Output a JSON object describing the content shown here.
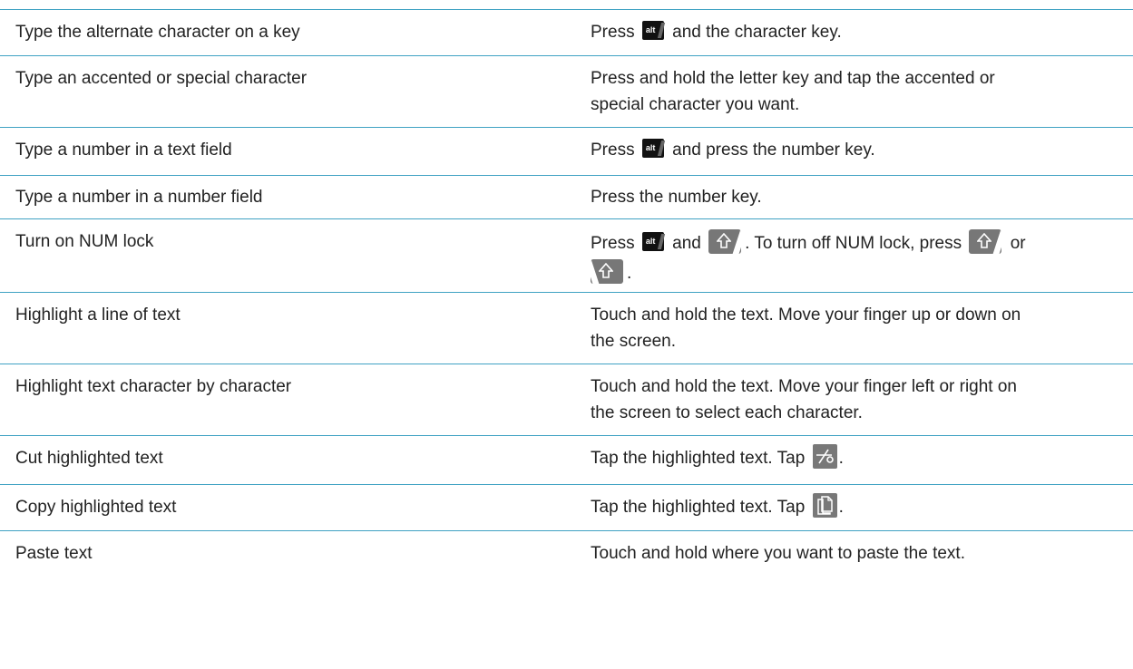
{
  "rows": [
    {
      "action": "Type the alternate character on a key",
      "result": [
        "Press",
        "alt",
        "and the character key."
      ]
    },
    {
      "action": "Type an accented or special character",
      "result": [
        "Press and hold the letter key and tap the accented or",
        "special character you want."
      ]
    },
    {
      "action": "Type a number in a text field",
      "result": [
        "Press",
        "alt",
        "and press the number key."
      ]
    },
    {
      "action": "Type a number in a number field",
      "result": [
        "Press the number key."
      ]
    },
    {
      "action": "Turn on NUM lock",
      "result": [
        "Press",
        "alt",
        "and",
        ". To turn off NUM lock, press",
        "or",
        "."
      ]
    },
    {
      "action": "Highlight a line of text",
      "result": [
        "Touch and hold the text. Move your finger up or down on",
        "the screen."
      ]
    },
    {
      "action": "Highlight text character by character",
      "result": [
        "Touch and hold the text. Move your finger left or right on",
        "the screen to select each character."
      ]
    },
    {
      "action": "Cut highlighted text",
      "result": [
        "Tap the highlighted text. Tap",
        "."
      ]
    },
    {
      "action": "Copy highlighted text",
      "result": [
        "Tap the highlighted text. Tap",
        "."
      ]
    },
    {
      "action": "Paste text",
      "result": [
        "Touch and hold where you want to paste the text."
      ]
    }
  ],
  "icons": {
    "alt_key": "alt-key-icon",
    "shift_key_right": "right-shift-key-icon",
    "shift_key_left": "left-shift-key-icon",
    "cut": "scissors-icon",
    "copy": "copy-icon"
  },
  "colors": {
    "rule": "#3fa2c3",
    "text": "#222222",
    "key_dark": "#111111",
    "key_gray": "#777777"
  }
}
